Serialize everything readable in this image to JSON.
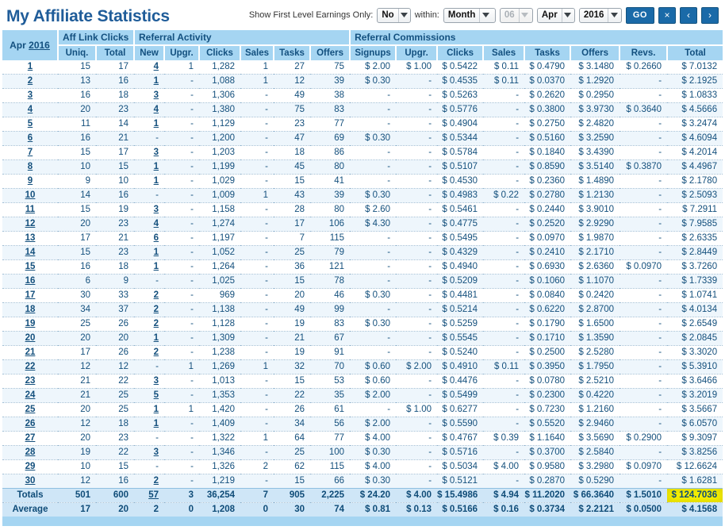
{
  "page": {
    "title": "My Affiliate Statistics"
  },
  "controls": {
    "show_first_level_label": "Show First Level Earnings Only:",
    "show_first_level_value": "No",
    "within_label": "within:",
    "period_value": "Month",
    "day_value": "06",
    "month_value": "Apr",
    "year_value": "2016",
    "go_label": "GO",
    "clear_label": "×",
    "prev_label": "‹",
    "next_label": "›"
  },
  "table": {
    "corner_month": "Apr",
    "corner_year": "2016",
    "groups": [
      {
        "label": "Aff Link Clicks",
        "span": 2
      },
      {
        "label": "Referral Activity",
        "span": 6
      },
      {
        "label": "Referral Commissions",
        "span": 8
      }
    ],
    "columns": [
      "Uniq.",
      "Total",
      "New",
      "Upgr.",
      "Clicks",
      "Sales",
      "Tasks",
      "Offers",
      "Signups",
      "Upgr.",
      "Clicks",
      "Sales",
      "Tasks",
      "Offers",
      "Revs.",
      "Total"
    ],
    "rows": [
      {
        "day": "1",
        "cells": [
          "15",
          "17",
          "4",
          "1",
          "1,282",
          "1",
          "27",
          "75",
          "$ 2.00",
          "$ 1.00",
          "$ 0.5422",
          "$ 0.11",
          "$ 0.4790",
          "$ 3.1480",
          "$ 0.2660",
          "$ 7.0132"
        ]
      },
      {
        "day": "2",
        "cells": [
          "13",
          "16",
          "1",
          "-",
          "1,088",
          "1",
          "12",
          "39",
          "$ 0.30",
          "-",
          "$ 0.4535",
          "$ 0.11",
          "$ 0.0370",
          "$ 1.2920",
          "-",
          "$ 2.1925"
        ]
      },
      {
        "day": "3",
        "cells": [
          "16",
          "18",
          "3",
          "-",
          "1,306",
          "-",
          "49",
          "38",
          "-",
          "-",
          "$ 0.5263",
          "-",
          "$ 0.2620",
          "$ 0.2950",
          "-",
          "$ 1.0833"
        ]
      },
      {
        "day": "4",
        "cells": [
          "20",
          "23",
          "4",
          "-",
          "1,380",
          "-",
          "75",
          "83",
          "-",
          "-",
          "$ 0.5776",
          "-",
          "$ 0.3800",
          "$ 3.9730",
          "$ 0.3640",
          "$ 4.5666"
        ]
      },
      {
        "day": "5",
        "cells": [
          "11",
          "14",
          "1",
          "-",
          "1,129",
          "-",
          "23",
          "77",
          "-",
          "-",
          "$ 0.4904",
          "-",
          "$ 0.2750",
          "$ 2.4820",
          "-",
          "$ 3.2474"
        ]
      },
      {
        "day": "6",
        "cells": [
          "16",
          "21",
          "-",
          "-",
          "1,200",
          "-",
          "47",
          "69",
          "$ 0.30",
          "-",
          "$ 0.5344",
          "-",
          "$ 0.5160",
          "$ 3.2590",
          "-",
          "$ 4.6094"
        ]
      },
      {
        "day": "7",
        "cells": [
          "15",
          "17",
          "3",
          "-",
          "1,203",
          "-",
          "18",
          "86",
          "-",
          "-",
          "$ 0.5784",
          "-",
          "$ 0.1840",
          "$ 3.4390",
          "-",
          "$ 4.2014"
        ]
      },
      {
        "day": "8",
        "cells": [
          "10",
          "15",
          "1",
          "-",
          "1,199",
          "-",
          "45",
          "80",
          "-",
          "-",
          "$ 0.5107",
          "-",
          "$ 0.8590",
          "$ 3.5140",
          "$ 0.3870",
          "$ 4.4967"
        ]
      },
      {
        "day": "9",
        "cells": [
          "9",
          "10",
          "1",
          "-",
          "1,029",
          "-",
          "15",
          "41",
          "-",
          "-",
          "$ 0.4530",
          "-",
          "$ 0.2360",
          "$ 1.4890",
          "-",
          "$ 2.1780"
        ]
      },
      {
        "day": "10",
        "cells": [
          "14",
          "16",
          "-",
          "-",
          "1,009",
          "1",
          "43",
          "39",
          "$ 0.30",
          "-",
          "$ 0.4983",
          "$ 0.22",
          "$ 0.2780",
          "$ 1.2130",
          "-",
          "$ 2.5093"
        ]
      },
      {
        "day": "11",
        "cells": [
          "15",
          "19",
          "3",
          "-",
          "1,158",
          "-",
          "28",
          "80",
          "$ 2.60",
          "-",
          "$ 0.5461",
          "-",
          "$ 0.2440",
          "$ 3.9010",
          "-",
          "$ 7.2911"
        ]
      },
      {
        "day": "12",
        "cells": [
          "20",
          "23",
          "4",
          "-",
          "1,274",
          "-",
          "17",
          "106",
          "$ 4.30",
          "-",
          "$ 0.4775",
          "-",
          "$ 0.2520",
          "$ 2.9290",
          "-",
          "$ 7.9585"
        ]
      },
      {
        "day": "13",
        "cells": [
          "17",
          "21",
          "6",
          "-",
          "1,197",
          "-",
          "7",
          "115",
          "-",
          "-",
          "$ 0.5495",
          "-",
          "$ 0.0970",
          "$ 1.9870",
          "-",
          "$ 2.6335"
        ]
      },
      {
        "day": "14",
        "cells": [
          "15",
          "23",
          "1",
          "-",
          "1,052",
          "-",
          "25",
          "79",
          "-",
          "-",
          "$ 0.4329",
          "-",
          "$ 0.2410",
          "$ 2.1710",
          "-",
          "$ 2.8449"
        ]
      },
      {
        "day": "15",
        "cells": [
          "16",
          "18",
          "1",
          "-",
          "1,264",
          "-",
          "36",
          "121",
          "-",
          "-",
          "$ 0.4940",
          "-",
          "$ 0.6930",
          "$ 2.6360",
          "$ 0.0970",
          "$ 3.7260"
        ]
      },
      {
        "day": "16",
        "cells": [
          "6",
          "9",
          "-",
          "-",
          "1,025",
          "-",
          "15",
          "78",
          "-",
          "-",
          "$ 0.5209",
          "-",
          "$ 0.1060",
          "$ 1.1070",
          "-",
          "$ 1.7339"
        ]
      },
      {
        "day": "17",
        "cells": [
          "30",
          "33",
          "2",
          "-",
          "969",
          "-",
          "20",
          "46",
          "$ 0.30",
          "-",
          "$ 0.4481",
          "-",
          "$ 0.0840",
          "$ 0.2420",
          "-",
          "$ 1.0741"
        ]
      },
      {
        "day": "18",
        "cells": [
          "34",
          "37",
          "2",
          "-",
          "1,138",
          "-",
          "49",
          "99",
          "-",
          "-",
          "$ 0.5214",
          "-",
          "$ 0.6220",
          "$ 2.8700",
          "-",
          "$ 4.0134"
        ]
      },
      {
        "day": "19",
        "cells": [
          "25",
          "26",
          "2",
          "-",
          "1,128",
          "-",
          "19",
          "83",
          "$ 0.30",
          "-",
          "$ 0.5259",
          "-",
          "$ 0.1790",
          "$ 1.6500",
          "-",
          "$ 2.6549"
        ]
      },
      {
        "day": "20",
        "cells": [
          "20",
          "20",
          "1",
          "-",
          "1,309",
          "-",
          "21",
          "67",
          "-",
          "-",
          "$ 0.5545",
          "-",
          "$ 0.1710",
          "$ 1.3590",
          "-",
          "$ 2.0845"
        ]
      },
      {
        "day": "21",
        "cells": [
          "17",
          "26",
          "2",
          "-",
          "1,238",
          "-",
          "19",
          "91",
          "-",
          "-",
          "$ 0.5240",
          "-",
          "$ 0.2500",
          "$ 2.5280",
          "-",
          "$ 3.3020"
        ]
      },
      {
        "day": "22",
        "cells": [
          "12",
          "12",
          "-",
          "1",
          "1,269",
          "1",
          "32",
          "70",
          "$ 0.60",
          "$ 2.00",
          "$ 0.4910",
          "$ 0.11",
          "$ 0.3950",
          "$ 1.7950",
          "-",
          "$ 5.3910"
        ]
      },
      {
        "day": "23",
        "cells": [
          "21",
          "22",
          "3",
          "-",
          "1,013",
          "-",
          "15",
          "53",
          "$ 0.60",
          "-",
          "$ 0.4476",
          "-",
          "$ 0.0780",
          "$ 2.5210",
          "-",
          "$ 3.6466"
        ]
      },
      {
        "day": "24",
        "cells": [
          "21",
          "25",
          "5",
          "-",
          "1,353",
          "-",
          "22",
          "35",
          "$ 2.00",
          "-",
          "$ 0.5499",
          "-",
          "$ 0.2300",
          "$ 0.4220",
          "-",
          "$ 3.2019"
        ]
      },
      {
        "day": "25",
        "cells": [
          "20",
          "25",
          "1",
          "1",
          "1,420",
          "-",
          "26",
          "61",
          "-",
          "$ 1.00",
          "$ 0.6277",
          "-",
          "$ 0.7230",
          "$ 1.2160",
          "-",
          "$ 3.5667"
        ]
      },
      {
        "day": "26",
        "cells": [
          "12",
          "18",
          "1",
          "-",
          "1,409",
          "-",
          "34",
          "56",
          "$ 2.00",
          "-",
          "$ 0.5590",
          "-",
          "$ 0.5520",
          "$ 2.9460",
          "-",
          "$ 6.0570"
        ]
      },
      {
        "day": "27",
        "cells": [
          "20",
          "23",
          "-",
          "-",
          "1,322",
          "1",
          "64",
          "77",
          "$ 4.00",
          "-",
          "$ 0.4767",
          "$ 0.39",
          "$ 1.1640",
          "$ 3.5690",
          "$ 0.2900",
          "$ 9.3097"
        ]
      },
      {
        "day": "28",
        "cells": [
          "19",
          "22",
          "3",
          "-",
          "1,346",
          "-",
          "25",
          "100",
          "$ 0.30",
          "-",
          "$ 0.5716",
          "-",
          "$ 0.3700",
          "$ 2.5840",
          "-",
          "$ 3.8256"
        ]
      },
      {
        "day": "29",
        "cells": [
          "10",
          "15",
          "-",
          "-",
          "1,326",
          "2",
          "62",
          "115",
          "$ 4.00",
          "-",
          "$ 0.5034",
          "$ 4.00",
          "$ 0.9580",
          "$ 3.2980",
          "$ 0.0970",
          "$ 12.6624"
        ]
      },
      {
        "day": "30",
        "cells": [
          "12",
          "16",
          "2",
          "-",
          "1,219",
          "-",
          "15",
          "66",
          "$ 0.30",
          "-",
          "$ 0.5121",
          "-",
          "$ 0.2870",
          "$ 0.5290",
          "-",
          "$ 1.6281"
        ]
      }
    ],
    "totals": {
      "label": "Totals",
      "cells": [
        "501",
        "600",
        "57",
        "3",
        "36,254",
        "7",
        "905",
        "2,225",
        "$ 24.20",
        "$ 4.00",
        "$ 15.4986",
        "$ 4.94",
        "$ 11.2020",
        "$ 66.3640",
        "$ 1.5010",
        "$ 124.7036"
      ]
    },
    "average": {
      "label": "Average",
      "cells": [
        "17",
        "20",
        "2",
        "0",
        "1,208",
        "0",
        "30",
        "74",
        "$ 0.81",
        "$ 0.13",
        "$ 0.5166",
        "$ 0.16",
        "$ 0.3734",
        "$ 2.2121",
        "$ 0.0500",
        "$ 4.1568"
      ]
    }
  },
  "colors": {
    "header_bg": "#a5d5f2",
    "totals_bg": "#cfe6f7",
    "text": "#14507d",
    "title": "#1f5c99",
    "button": "#1a6aa8",
    "highlight": "#f5f000",
    "row_alt": "#eef6fc"
  }
}
